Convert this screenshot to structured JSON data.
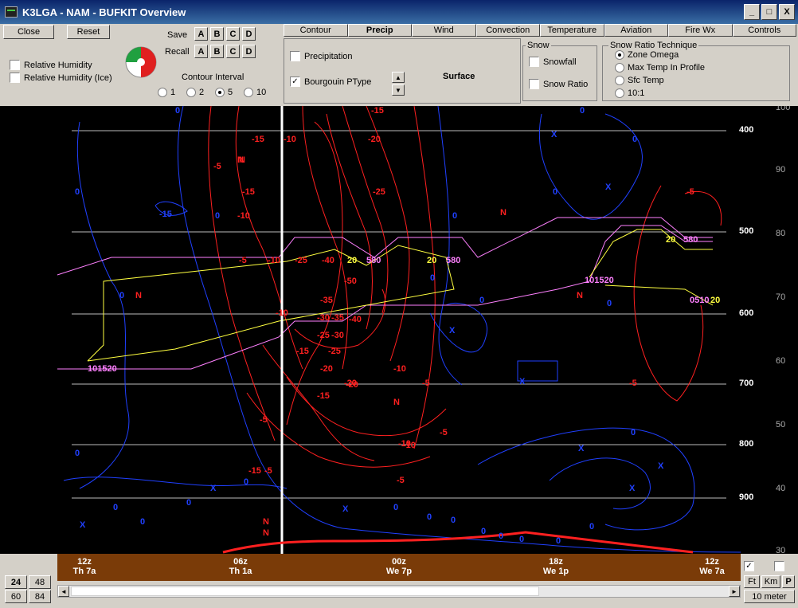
{
  "window": {
    "title": "K3LGA - NAM - BUFKIT Overview",
    "minimize": "_",
    "maximize": "□",
    "close": "X"
  },
  "buttons": {
    "close": "Close",
    "reset": "Reset"
  },
  "save": {
    "label": "Save",
    "slots": [
      "A",
      "B",
      "C",
      "D"
    ]
  },
  "recall": {
    "label": "Recall",
    "slots": [
      "A",
      "B",
      "C",
      "D"
    ]
  },
  "checks": {
    "rh": "Relative Humidity",
    "rh_ice": "Relative Humidity (Ice)"
  },
  "contour": {
    "label": "Contour Interval",
    "options": [
      "1",
      "2",
      "5",
      "10"
    ],
    "selected": "5"
  },
  "tabs": [
    "Contour",
    "Precip",
    "Wind",
    "Convection",
    "Temperature",
    "Aviation",
    "Fire Wx",
    "Controls"
  ],
  "active_tab": "Precip",
  "precip": {
    "precipitation": "Precipitation",
    "bourgouin": "Bourgouin PType",
    "level": "Surface",
    "check_mark": "✓",
    "up": "▲",
    "down": "▼"
  },
  "snow": {
    "title": "Snow",
    "snowfall": "Snowfall",
    "snow_ratio": "Snow Ratio"
  },
  "ratio": {
    "title": "Snow Ratio Technique",
    "options": [
      "Zone Omega",
      "Max Temp In Profile",
      "Sfc Temp",
      "10:1"
    ],
    "selected": "Zone Omega"
  },
  "plot": {
    "pressure_labels": [
      "400",
      "500",
      "600",
      "700",
      "800",
      "900"
    ],
    "rh_labels": [
      "100",
      "90",
      "80",
      "70",
      "60",
      "50",
      "40",
      "30"
    ],
    "temp_labels": [
      {
        "t": "-15",
        "c": "r"
      },
      {
        "t": "-10",
        "c": "r"
      },
      {
        "t": "-15",
        "c": "r"
      },
      {
        "t": "-5",
        "c": "r"
      },
      {
        "t": "N",
        "c": "r"
      },
      {
        "t": "-15",
        "c": "r"
      },
      {
        "t": "-10",
        "c": "r"
      },
      {
        "t": "-5",
        "c": "r"
      },
      {
        "t": "-10",
        "c": "r"
      },
      {
        "t": "-25",
        "c": "r"
      },
      {
        "t": "-40",
        "c": "r"
      },
      {
        "t": "-50",
        "c": "r"
      },
      {
        "t": "-35",
        "c": "r"
      },
      {
        "t": "-40",
        "c": "r"
      },
      {
        "t": "-30",
        "c": "r"
      },
      {
        "t": "-35",
        "c": "r"
      },
      {
        "t": "-25",
        "c": "r"
      },
      {
        "t": "-30",
        "c": "r"
      },
      {
        "t": "-25",
        "c": "r"
      },
      {
        "t": "-20",
        "c": "r"
      },
      {
        "t": "-15",
        "c": "r"
      },
      {
        "t": "-20",
        "c": "r"
      },
      {
        "t": "-15",
        "c": "r"
      },
      {
        "t": "-10",
        "c": "r"
      },
      {
        "t": "-10",
        "c": "r"
      },
      {
        "t": "-5",
        "c": "r"
      },
      {
        "t": "-5",
        "c": "r"
      },
      {
        "t": "-10",
        "c": "r"
      },
      {
        "t": "-5",
        "c": "r"
      },
      {
        "t": "-5",
        "c": "r"
      },
      {
        "t": "-5",
        "c": "r"
      },
      {
        "t": "-15",
        "c": "r"
      },
      {
        "t": "-20",
        "c": "r"
      },
      {
        "t": "-25",
        "c": "r"
      },
      {
        "t": "N",
        "c": "r"
      },
      {
        "t": "N",
        "c": "r"
      },
      {
        "t": "N",
        "c": "r"
      },
      {
        "t": "N",
        "c": "r"
      },
      {
        "t": "N",
        "c": "r"
      },
      {
        "t": "N",
        "c": "r"
      },
      {
        "t": "N",
        "c": "r"
      },
      {
        "t": "-5",
        "c": "r"
      },
      {
        "t": "-20",
        "c": "r"
      },
      {
        "t": "-10",
        "c": "r"
      },
      {
        "t": "20",
        "c": "y"
      },
      {
        "t": "580",
        "c": "p"
      },
      {
        "t": "20",
        "c": "y"
      },
      {
        "t": "580",
        "c": "p"
      },
      {
        "t": "20",
        "c": "y"
      },
      {
        "t": "580",
        "c": "p"
      },
      {
        "t": "101520",
        "c": "p"
      },
      {
        "t": "101520",
        "c": "p"
      },
      {
        "t": "0510",
        "c": "p"
      },
      {
        "t": "20",
        "c": "y"
      },
      {
        "t": "0",
        "c": "b"
      },
      {
        "t": "0",
        "c": "b"
      },
      {
        "t": "0",
        "c": "b"
      },
      {
        "t": "0",
        "c": "b"
      },
      {
        "t": "0",
        "c": "b"
      },
      {
        "t": "0",
        "c": "b"
      },
      {
        "t": "0",
        "c": "b"
      },
      {
        "t": "0",
        "c": "b"
      },
      {
        "t": "0",
        "c": "b"
      },
      {
        "t": "0",
        "c": "b"
      },
      {
        "t": "0",
        "c": "b"
      },
      {
        "t": "0",
        "c": "b"
      },
      {
        "t": "0",
        "c": "b"
      },
      {
        "t": "0",
        "c": "b"
      },
      {
        "t": "0",
        "c": "b"
      },
      {
        "t": "0",
        "c": "b"
      },
      {
        "t": "0",
        "c": "b"
      },
      {
        "t": "0",
        "c": "b"
      },
      {
        "t": "0",
        "c": "b"
      },
      {
        "t": "0",
        "c": "b"
      },
      {
        "t": "0",
        "c": "b"
      },
      {
        "t": "0",
        "c": "b"
      },
      {
        "t": "0",
        "c": "b"
      },
      {
        "t": "0",
        "c": "b"
      },
      {
        "t": "0",
        "c": "b"
      },
      {
        "t": "-5",
        "c": "r"
      },
      {
        "t": "-15",
        "c": "b"
      },
      {
        "t": "X",
        "c": "b"
      },
      {
        "t": "X",
        "c": "b"
      },
      {
        "t": "X",
        "c": "b"
      },
      {
        "t": "X",
        "c": "b"
      },
      {
        "t": "X",
        "c": "b"
      },
      {
        "t": "X",
        "c": "b"
      },
      {
        "t": "X",
        "c": "b"
      },
      {
        "t": "X",
        "c": "b"
      },
      {
        "t": "X",
        "c": "b"
      },
      {
        "t": "X",
        "c": "b"
      }
    ]
  },
  "time_axis": [
    {
      "top": "12z",
      "bottom": "Th 7a"
    },
    {
      "top": "06z",
      "bottom": "Th 1a"
    },
    {
      "top": "00z",
      "bottom": "We 7p"
    },
    {
      "top": "18z",
      "bottom": "We 1p"
    },
    {
      "top": "12z",
      "bottom": "We 7a"
    }
  ],
  "bottom_left": [
    "24",
    "48",
    "60",
    "84"
  ],
  "bottom_right": {
    "units": [
      "Ft",
      "Km",
      "P"
    ],
    "height": "10 meter"
  },
  "scroll": {
    "left": "◄",
    "right": "►"
  },
  "colors": {
    "temp": "#ff2020",
    "rh": "#2040ff",
    "snow_yellow": "#ffff40",
    "snow_pink": "#ff80ff",
    "axis_bar": "#7a3b08"
  }
}
